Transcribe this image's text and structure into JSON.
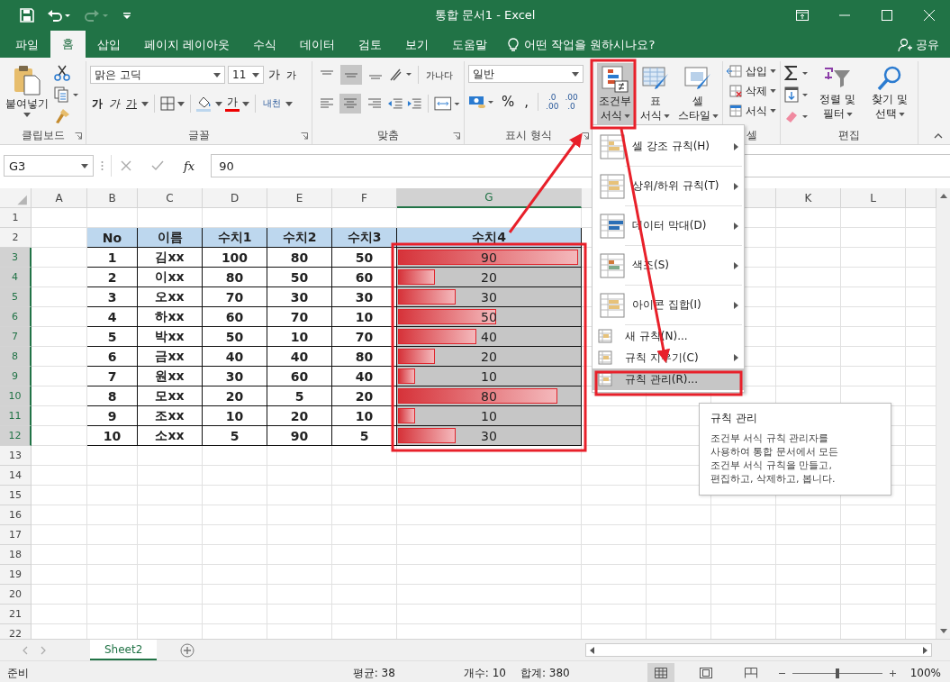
{
  "window": {
    "title": "통합 문서1  -  Excel"
  },
  "tabs": [
    {
      "label": "파일",
      "selected": false
    },
    {
      "label": "홈",
      "selected": true
    },
    {
      "label": "삽입",
      "selected": false
    },
    {
      "label": "페이지 레이아웃",
      "selected": false
    },
    {
      "label": "수식",
      "selected": false
    },
    {
      "label": "데이터",
      "selected": false
    },
    {
      "label": "검토",
      "selected": false
    },
    {
      "label": "보기",
      "selected": false
    },
    {
      "label": "도움말",
      "selected": false
    }
  ],
  "tell_me": "어떤 작업을 원하시나요?",
  "share": "공유",
  "ribbon": {
    "clipboard": {
      "paste": "붙여넣기",
      "label": "클립보드"
    },
    "font": {
      "name": "맑은 고딕",
      "size": "11",
      "grow": "가",
      "shrink": "가",
      "bold": "가",
      "italic": "가",
      "underline": "가",
      "font_color": "가",
      "phonetic": "내천",
      "label": "글꼴"
    },
    "alignment": {
      "vertical": [
        {
          "selected": false
        },
        {
          "selected": true
        },
        {
          "selected": false
        }
      ],
      "wrap": "가나다",
      "horizontal": [
        {
          "selected": false
        },
        {
          "selected": true
        },
        {
          "selected": false
        }
      ],
      "label": "맞춤"
    },
    "number": {
      "format": "일반",
      "percent": "%",
      "comma": ",",
      "increase_decimal": {
        "top": ".0",
        "bottom": ".00"
      },
      "decrease_decimal": {
        "top": ".00",
        "bottom": ".0"
      },
      "label": "표시 형식"
    },
    "styles": {
      "buttons": [
        {
          "lines": [
            "조건부",
            "서식"
          ],
          "selected": true,
          "kind": "conditional"
        },
        {
          "lines": [
            "표",
            "서식"
          ],
          "selected": false,
          "kind": "table"
        },
        {
          "lines": [
            "셀",
            "스타일"
          ],
          "selected": false,
          "kind": "cell"
        }
      ]
    },
    "cells": {
      "buttons": [
        "삽입",
        "삭제",
        "서식"
      ],
      "label": "셀"
    },
    "editing": {
      "buttons": [
        {
          "lines": [
            "정렬 및",
            "필터"
          ]
        },
        {
          "lines": [
            "찾기 및",
            "선택"
          ]
        }
      ],
      "label": "편집"
    }
  },
  "formula_bar": {
    "name_box": "G3",
    "fx": "fx",
    "value": "90"
  },
  "sheet": {
    "headers_left": [
      {
        "label": "A",
        "selected": false
      },
      {
        "label": "B",
        "selected": false
      },
      {
        "label": "C",
        "selected": false
      },
      {
        "label": "D",
        "selected": false
      },
      {
        "label": "E",
        "selected": false
      },
      {
        "label": "F",
        "selected": false
      },
      {
        "label": "G",
        "selected": true
      }
    ],
    "headers_right": [
      {
        "label": "K",
        "selected": false
      },
      {
        "label": "L",
        "selected": false
      }
    ],
    "row_numbers": [
      {
        "label": "1",
        "selected": false
      },
      {
        "label": "2",
        "selected": false
      },
      {
        "label": "3",
        "selected": true
      },
      {
        "label": "4",
        "selected": true
      },
      {
        "label": "5",
        "selected": true
      },
      {
        "label": "6",
        "selected": true
      },
      {
        "label": "7",
        "selected": true
      },
      {
        "label": "8",
        "selected": true
      },
      {
        "label": "9",
        "selected": true
      },
      {
        "label": "10",
        "selected": true
      },
      {
        "label": "11",
        "selected": true
      },
      {
        "label": "12",
        "selected": true
      },
      {
        "label": "13",
        "selected": false
      },
      {
        "label": "14",
        "selected": false
      },
      {
        "label": "15",
        "selected": false
      },
      {
        "label": "16",
        "selected": false
      },
      {
        "label": "17",
        "selected": false
      },
      {
        "label": "18",
        "selected": false
      },
      {
        "label": "19",
        "selected": false
      },
      {
        "label": "20",
        "selected": false
      },
      {
        "label": "21",
        "selected": false
      },
      {
        "label": "22",
        "selected": false
      }
    ],
    "table": {
      "columns": [
        "No",
        "이름",
        "수치1",
        "수치2",
        "수치3",
        "수치4"
      ],
      "rows": [
        {
          "cells": [
            "1",
            "김xx",
            "100",
            "80",
            "50",
            "90"
          ],
          "level": 1
        },
        {
          "cells": [
            "2",
            "이xx",
            "80",
            "50",
            "60",
            "20"
          ],
          "level": 0.222
        },
        {
          "cells": [
            "3",
            "오xx",
            "70",
            "30",
            "30",
            "30"
          ],
          "level": 0.333
        },
        {
          "cells": [
            "4",
            "하xx",
            "60",
            "70",
            "10",
            "50"
          ],
          "level": 0.556
        },
        {
          "cells": [
            "5",
            "박xx",
            "50",
            "10",
            "70",
            "40"
          ],
          "level": 0.444
        },
        {
          "cells": [
            "6",
            "금xx",
            "40",
            "40",
            "80",
            "20"
          ],
          "level": 0.222
        },
        {
          "cells": [
            "7",
            "원xx",
            "30",
            "60",
            "40",
            "10"
          ],
          "level": 0.111
        },
        {
          "cells": [
            "8",
            "모xx",
            "20",
            "5",
            "20",
            "80"
          ],
          "level": 0.889
        },
        {
          "cells": [
            "9",
            "조xx",
            "10",
            "20",
            "10",
            "10"
          ],
          "level": 0.111
        },
        {
          "cells": [
            "10",
            "소xx",
            "5",
            "90",
            "5",
            "30"
          ],
          "level": 0.333
        }
      ]
    }
  },
  "menu": {
    "items": [
      {
        "label": "셀 강조 규칙(H)",
        "kind": "large",
        "submenu": true,
        "selected": false
      },
      {
        "label": "상위/하위 규칙(T)",
        "kind": "large",
        "submenu": true,
        "selected": false
      },
      {
        "label": "데이터 막대(D)",
        "kind": "large",
        "submenu": true,
        "selected": false
      },
      {
        "label": "색조(S)",
        "kind": "large",
        "submenu": true,
        "selected": false
      },
      {
        "label": "아이콘 집합(I)",
        "kind": "large",
        "submenu": true,
        "selected": false
      },
      {
        "label": "새 규칙(N)...",
        "kind": "small",
        "submenu": false,
        "selected": false
      },
      {
        "label": "규칙 지우기(C)",
        "kind": "small",
        "submenu": true,
        "selected": false
      },
      {
        "label": "규칙 관리(R)...",
        "kind": "small",
        "submenu": false,
        "selected": true
      }
    ]
  },
  "tooltip": {
    "title": "규칙 관리",
    "body": "조건부 서식 규칙 관리자를\n사용하여 통합 문서에서 모든\n조건부 서식 규칙을 만들고,\n편집하고, 삭제하고, 봅니다."
  },
  "sheet_tabs": [
    {
      "label": "Sheet2",
      "selected": true
    }
  ],
  "status_bar": {
    "mode": "준비",
    "average": "평균: 38",
    "count": "개수: 10",
    "sum": "합계: 380",
    "zoom_slider": {
      "level": 0.5
    },
    "zoom": "100%"
  }
}
